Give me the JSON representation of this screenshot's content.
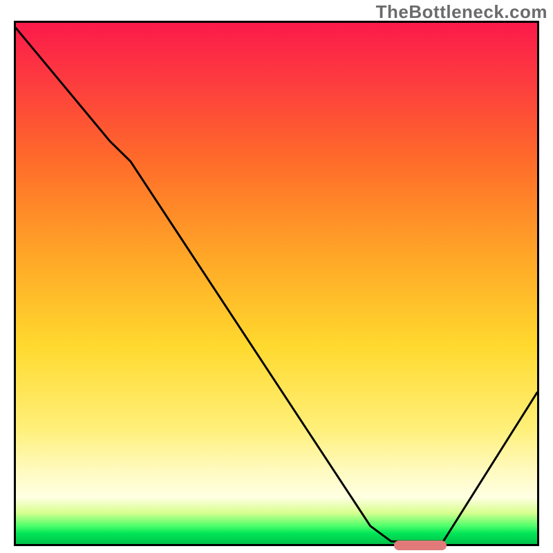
{
  "watermark": "TheBottleneck.com",
  "chart_data": {
    "type": "line",
    "title": "",
    "xlabel": "",
    "ylabel": "",
    "xlim": [
      0,
      100
    ],
    "ylim": [
      0,
      100
    ],
    "grid": false,
    "legend": false,
    "series": [
      {
        "name": "bottleneck-curve",
        "x": [
          0,
          18,
          22,
          68,
          72,
          82,
          100
        ],
        "values": [
          100,
          78,
          74,
          3,
          0,
          0,
          29
        ]
      }
    ],
    "annotations": [
      {
        "name": "optimal-range-marker",
        "x_start": 72,
        "x_end": 82,
        "y": 0,
        "color": "#e27a7a"
      }
    ],
    "background": "red-yellow-green-vertical-gradient"
  }
}
